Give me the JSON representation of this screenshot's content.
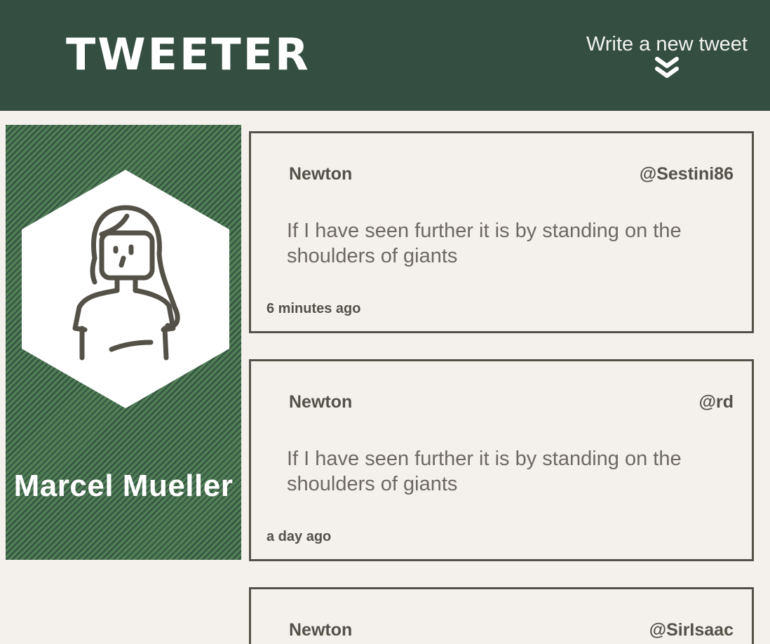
{
  "header": {
    "logo": "TWEETER",
    "compose_label": "Write a new tweet",
    "compose_icon": "double-chevron-down-icon",
    "background": "#344e41"
  },
  "profile": {
    "name": "Marcel Mueller",
    "avatar_icon": "user-avatar-icon"
  },
  "tweets": [
    {
      "name": "Newton",
      "handle": "@Sestini86",
      "text": "If I have seen further it is by standing on the shoulders of giants",
      "time": "6 minutes ago"
    },
    {
      "name": "Newton",
      "handle": "@rd",
      "text": "If I have seen further it is by standing on the shoulders of giants",
      "time": "a day ago"
    },
    {
      "name": "Newton",
      "handle": "@SirIsaac"
    }
  ],
  "colors": {
    "header_bg": "#344e41",
    "page_bg": "#f4f1ec",
    "text": "#545149",
    "profile_green": "#4f7e55"
  }
}
